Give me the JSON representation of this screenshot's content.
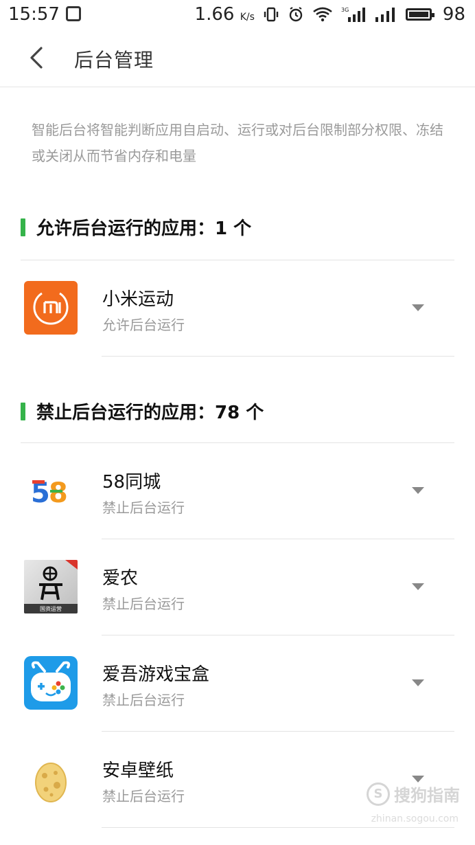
{
  "status_bar": {
    "time": "15:57",
    "speed": "1.66",
    "speed_unit": "K/s",
    "network": "3G",
    "battery": "98"
  },
  "header": {
    "title": "后台管理"
  },
  "description": "智能后台将智能判断应用自启动、运行或对后台限制部分权限、冻结或关闭从而节省内存和电量",
  "sections": [
    {
      "title": "允许后台运行的应用：1 个",
      "accent": "#35b34a",
      "apps": [
        {
          "name": "小米运动",
          "status": "允许后台运行",
          "icon": "mi-fit-icon",
          "icon_color": "#f26b1d",
          "icon_text": "mi"
        }
      ]
    },
    {
      "title": "禁止后台运行的应用：78 个",
      "accent": "#35b34a",
      "apps": [
        {
          "name": "58同城",
          "status": "禁止后台运行",
          "icon": "58-tongcheng-icon",
          "icon_text": "58"
        },
        {
          "name": "爱农",
          "status": "禁止后台运行",
          "icon": "ainong-icon",
          "icon_text": "国资运营"
        },
        {
          "name": "爱吾游戏宝盒",
          "status": "禁止后台运行",
          "icon": "aiwu-game-box-icon",
          "icon_color": "#1e9be8"
        },
        {
          "name": "安卓壁纸",
          "status": "禁止后台运行",
          "icon": "android-wallpaper-egg-icon",
          "icon_color": "#f2d27a"
        }
      ]
    }
  ],
  "watermark": {
    "text": "搜狗指南",
    "url": "zhinan.sogou.com"
  }
}
